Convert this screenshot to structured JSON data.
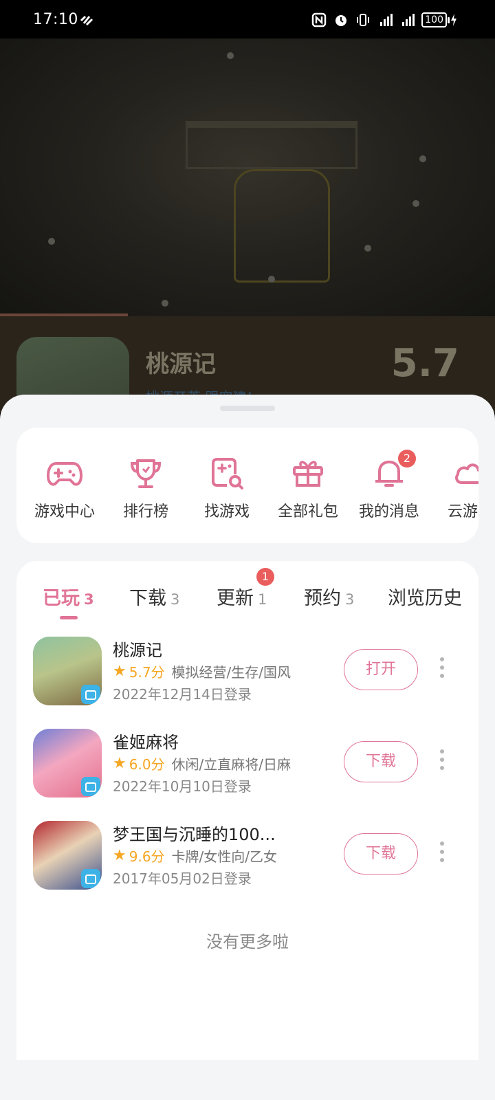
{
  "status_bar": {
    "time": "17:10",
    "battery": "100"
  },
  "hero": {
    "game_name": "桃源记",
    "tagline": "桃源开荒 跟宠建！",
    "score": "5.7"
  },
  "quick_actions": [
    {
      "label": "游戏中心",
      "icon": "gamepad-icon"
    },
    {
      "label": "排行榜",
      "icon": "trophy-icon"
    },
    {
      "label": "找游戏",
      "icon": "find-game-icon"
    },
    {
      "label": "全部礼包",
      "icon": "gift-icon"
    },
    {
      "label": "我的消息",
      "icon": "bell-icon",
      "badge": "2"
    },
    {
      "label": "云游戏",
      "icon": "cloud-icon"
    }
  ],
  "tabs": [
    {
      "label": "已玩",
      "count": "3",
      "active": true
    },
    {
      "label": "下载",
      "count": "3"
    },
    {
      "label": "更新",
      "count": "1",
      "badge": "1"
    },
    {
      "label": "预约",
      "count": "3"
    },
    {
      "label": "浏览历史",
      "count": ""
    }
  ],
  "games": [
    {
      "title": "桃源记",
      "score": "5.7分",
      "tags": "模拟经营/生存/国风",
      "date": "2022年12月14日登录",
      "action": "打开"
    },
    {
      "title": "雀姬麻将",
      "score": "6.0分",
      "tags": "休闲/立直麻将/日麻",
      "date": "2022年10月10日登录",
      "action": "下载"
    },
    {
      "title": "梦王国与沉睡的100...",
      "score": "9.6分",
      "tags": "卡牌/女性向/乙女",
      "date": "2017年05月02日登录",
      "action": "下载"
    }
  ],
  "footer_text": "没有更多啦",
  "colors": {
    "accent": "#e07496",
    "star": "#f5a623",
    "badge": "#ea5d5d"
  }
}
